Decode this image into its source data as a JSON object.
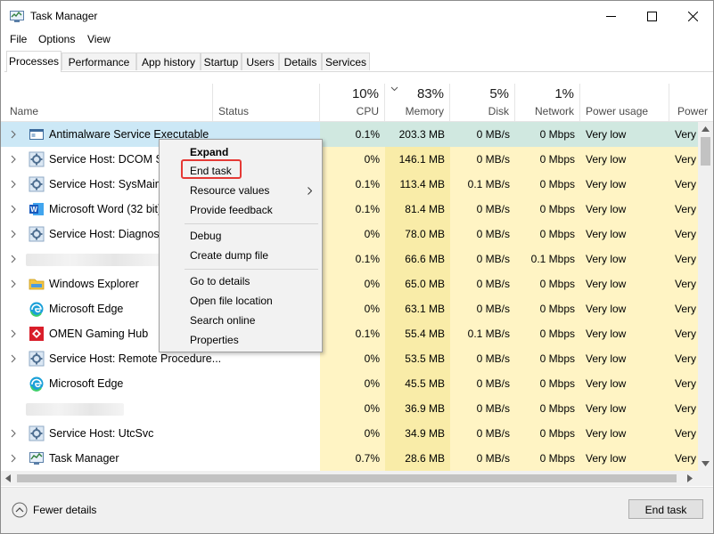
{
  "window": {
    "title": "Task Manager"
  },
  "menu": [
    "File",
    "Options",
    "View"
  ],
  "tabs": [
    "Processes",
    "Performance",
    "App history",
    "Startup",
    "Users",
    "Details",
    "Services"
  ],
  "header": {
    "name": "Name",
    "status": "Status",
    "cpu": {
      "pct": "10%",
      "label": "CPU"
    },
    "memory": {
      "pct": "83%",
      "label": "Memory"
    },
    "disk": {
      "pct": "5%",
      "label": "Disk"
    },
    "network": {
      "pct": "1%",
      "label": "Network"
    },
    "power_usage": "Power usage",
    "power_trend": "Power"
  },
  "rows": [
    {
      "name": "Antimalware Service Executable",
      "icon": "app-window-icon",
      "cpu": "0.1%",
      "memory": "203.3 MB",
      "disk": "0 MB/s",
      "network": "0 Mbps",
      "power": "Very low",
      "trend": "Very"
    },
    {
      "name": "Service Host: DCOM Se",
      "icon": "gear-icon",
      "cpu": "0%",
      "memory": "146.1 MB",
      "disk": "0 MB/s",
      "network": "0 Mbps",
      "power": "Very low",
      "trend": "Very"
    },
    {
      "name": "Service Host: SysMain",
      "icon": "gear-icon",
      "cpu": "0.1%",
      "memory": "113.4 MB",
      "disk": "0.1 MB/s",
      "network": "0 Mbps",
      "power": "Very low",
      "trend": "Very"
    },
    {
      "name": "Microsoft Word (32 bit)",
      "icon": "word-icon",
      "cpu": "0.1%",
      "memory": "81.4 MB",
      "disk": "0 MB/s",
      "network": "0 Mbps",
      "power": "Very low",
      "trend": "Very"
    },
    {
      "name": "Service Host: Diagnosti",
      "icon": "gear-icon",
      "cpu": "0%",
      "memory": "78.0 MB",
      "disk": "0 MB/s",
      "network": "0 Mbps",
      "power": "Very low",
      "trend": "Very"
    },
    {
      "name": "",
      "icon": "",
      "cpu": "0.1%",
      "memory": "66.6 MB",
      "disk": "0 MB/s",
      "network": "0.1 Mbps",
      "power": "Very low",
      "trend": "Very"
    },
    {
      "name": "Windows Explorer",
      "icon": "folder-icon",
      "cpu": "0%",
      "memory": "65.0 MB",
      "disk": "0 MB/s",
      "network": "0 Mbps",
      "power": "Very low",
      "trend": "Very"
    },
    {
      "name": "Microsoft Edge",
      "icon": "edge-icon",
      "cpu": "0%",
      "memory": "63.1 MB",
      "disk": "0 MB/s",
      "network": "0 Mbps",
      "power": "Very low",
      "trend": "Very"
    },
    {
      "name": "OMEN Gaming Hub",
      "icon": "omen-icon",
      "cpu": "0.1%",
      "memory": "55.4 MB",
      "disk": "0.1 MB/s",
      "network": "0 Mbps",
      "power": "Very low",
      "trend": "Very"
    },
    {
      "name": "Service Host: Remote Procedure...",
      "icon": "gear-icon",
      "cpu": "0%",
      "memory": "53.5 MB",
      "disk": "0 MB/s",
      "network": "0 Mbps",
      "power": "Very low",
      "trend": "Very"
    },
    {
      "name": "Microsoft Edge",
      "icon": "edge-icon",
      "cpu": "0%",
      "memory": "45.5 MB",
      "disk": "0 MB/s",
      "network": "0 Mbps",
      "power": "Very low",
      "trend": "Very"
    },
    {
      "name": "",
      "icon": "",
      "cpu": "0%",
      "memory": "36.9 MB",
      "disk": "0 MB/s",
      "network": "0 Mbps",
      "power": "Very low",
      "trend": "Very"
    },
    {
      "name": "Service Host: UtcSvc",
      "icon": "gear-icon",
      "cpu": "0%",
      "memory": "34.9 MB",
      "disk": "0 MB/s",
      "network": "0 Mbps",
      "power": "Very low",
      "trend": "Very"
    },
    {
      "name": "Task Manager",
      "icon": "task-manager-icon",
      "cpu": "0.7%",
      "memory": "28.6 MB",
      "disk": "0 MB/s",
      "network": "0 Mbps",
      "power": "Very low",
      "trend": "Very"
    }
  ],
  "context_menu": {
    "expand": "Expand",
    "end_task": "End task",
    "resource_values": "Resource values",
    "provide_feedback": "Provide feedback",
    "debug": "Debug",
    "create_dump_file": "Create dump file",
    "go_to_details": "Go to details",
    "open_file_location": "Open file location",
    "search_online": "Search online",
    "properties": "Properties"
  },
  "footer": {
    "fewer_details": "Fewer details",
    "end_task_button": "End task"
  },
  "colors": {
    "selection": "#cce8f6",
    "heat_light": "#fff4c4",
    "heat_mid": "#f9eca8",
    "highlight_box": "#e53935"
  }
}
